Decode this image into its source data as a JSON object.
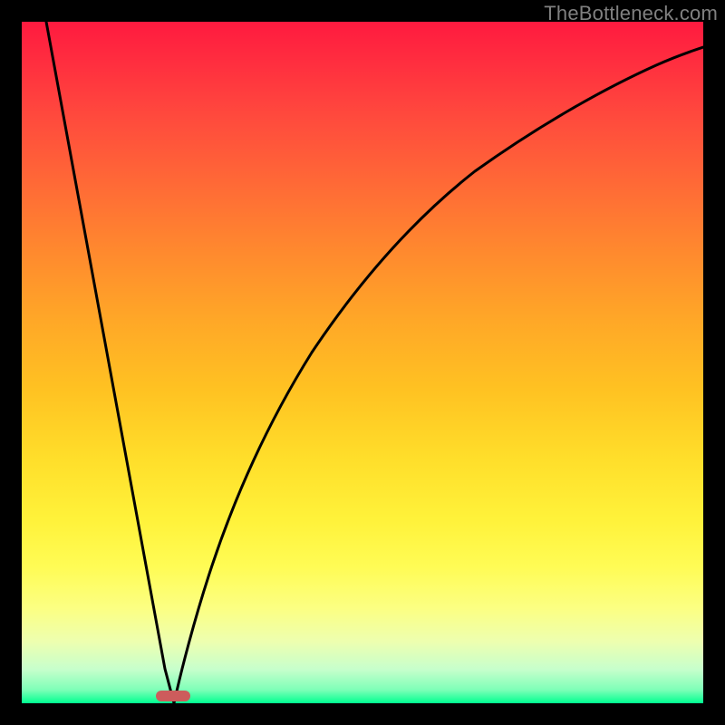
{
  "watermark": "TheBottleneck.com",
  "chart_data": {
    "type": "line",
    "title": "",
    "xlabel": "",
    "ylabel": "",
    "x_range": [
      0,
      752
    ],
    "y_range_percent": [
      0,
      100
    ],
    "gradient_stops": [
      {
        "pos": 0,
        "color": "#ff1a3f"
      },
      {
        "pos": 6,
        "color": "#ff2e3f"
      },
      {
        "pos": 14,
        "color": "#ff4a3d"
      },
      {
        "pos": 24,
        "color": "#ff6a36"
      },
      {
        "pos": 34,
        "color": "#ff8a2e"
      },
      {
        "pos": 44,
        "color": "#ffa827"
      },
      {
        "pos": 54,
        "color": "#ffc222"
      },
      {
        "pos": 64,
        "color": "#ffde2a"
      },
      {
        "pos": 73,
        "color": "#fff23a"
      },
      {
        "pos": 80,
        "color": "#fffc55"
      },
      {
        "pos": 86,
        "color": "#fcff82"
      },
      {
        "pos": 91,
        "color": "#edffb0"
      },
      {
        "pos": 95,
        "color": "#c7ffcc"
      },
      {
        "pos": 98,
        "color": "#7fffb8"
      },
      {
        "pos": 100,
        "color": "#00ff90"
      }
    ],
    "curve_points": [
      {
        "x": 27,
        "y_pct": 0
      },
      {
        "x": 60,
        "y_pct": 25
      },
      {
        "x": 95,
        "y_pct": 50
      },
      {
        "x": 130,
        "y_pct": 75
      },
      {
        "x": 158,
        "y_pct": 95
      },
      {
        "x": 168,
        "y_pct": 100
      },
      {
        "x": 180,
        "y_pct": 95
      },
      {
        "x": 200,
        "y_pct": 85
      },
      {
        "x": 230,
        "y_pct": 72
      },
      {
        "x": 270,
        "y_pct": 58
      },
      {
        "x": 320,
        "y_pct": 45
      },
      {
        "x": 380,
        "y_pct": 33
      },
      {
        "x": 450,
        "y_pct": 23
      },
      {
        "x": 530,
        "y_pct": 15
      },
      {
        "x": 620,
        "y_pct": 9
      },
      {
        "x": 700,
        "y_pct": 5
      },
      {
        "x": 752,
        "y_pct": 3
      }
    ],
    "marker": {
      "x_pct": 20,
      "y_pct": 99,
      "color": "#cd5c5c"
    }
  }
}
